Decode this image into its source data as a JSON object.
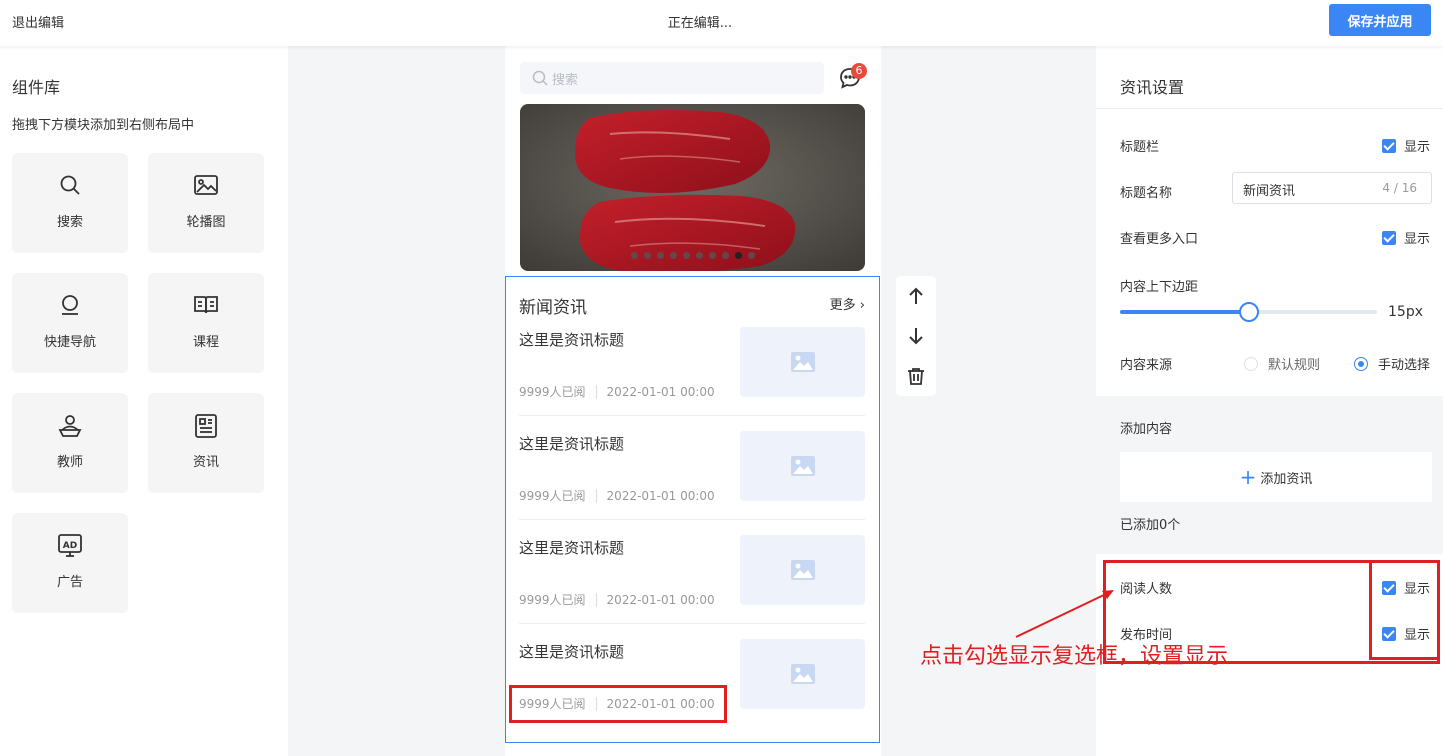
{
  "topbar": {
    "exit_label": "退出编辑",
    "status": "正在编辑...",
    "save_label": "保存并应用"
  },
  "library": {
    "title": "组件库",
    "hint": "拖拽下方模块添加到右侧布局中",
    "tiles": [
      {
        "label": "搜索",
        "icon": "search-icon"
      },
      {
        "label": "轮播图",
        "icon": "image-icon"
      },
      {
        "label": "快捷导航",
        "icon": "nav-icon"
      },
      {
        "label": "课程",
        "icon": "book-icon"
      },
      {
        "label": "教师",
        "icon": "teacher-icon"
      },
      {
        "label": "资讯",
        "icon": "newspaper-icon"
      },
      {
        "label": "广告",
        "icon": "ad-icon"
      }
    ]
  },
  "preview": {
    "search_placeholder": "搜索",
    "message_badge": "6",
    "banner_dots": 10,
    "banner_active_dot": 8,
    "news": {
      "title": "新闻资讯",
      "more_label": "更多",
      "items": [
        {
          "title": "这里是资讯标题",
          "readers": "9999人已阅",
          "time": "2022-01-01 00:00"
        },
        {
          "title": "这里是资讯标题",
          "readers": "9999人已阅",
          "time": "2022-01-01 00:00"
        },
        {
          "title": "这里是资讯标题",
          "readers": "9999人已阅",
          "time": "2022-01-01 00:00"
        },
        {
          "title": "这里是资讯标题",
          "readers": "9999人已阅",
          "time": "2022-01-01 00:00"
        }
      ]
    }
  },
  "settings": {
    "title": "资讯设置",
    "title_bar_label": "标题栏",
    "show_label": "显示",
    "title_name_label": "标题名称",
    "title_name_value": "新闻资讯",
    "title_name_count": "4 / 16",
    "more_entry_label": "查看更多入口",
    "padding_label": "内容上下边距",
    "padding_value": "15px",
    "padding_fraction": 0.5,
    "source_label": "内容来源",
    "source_options": [
      "默认规则",
      "手动选择"
    ],
    "source_selected": 1,
    "add_content_label": "添加内容",
    "add_button_label": "添加资讯",
    "added_count": "已添加0个",
    "readers_label": "阅读人数",
    "publish_time_label": "发布时间"
  },
  "annotation": {
    "text": "点击勾选显示复选框，设置显示"
  },
  "colors": {
    "accent": "#3a86f5",
    "annotation": "#e02020",
    "badge": "#e84b3c"
  }
}
